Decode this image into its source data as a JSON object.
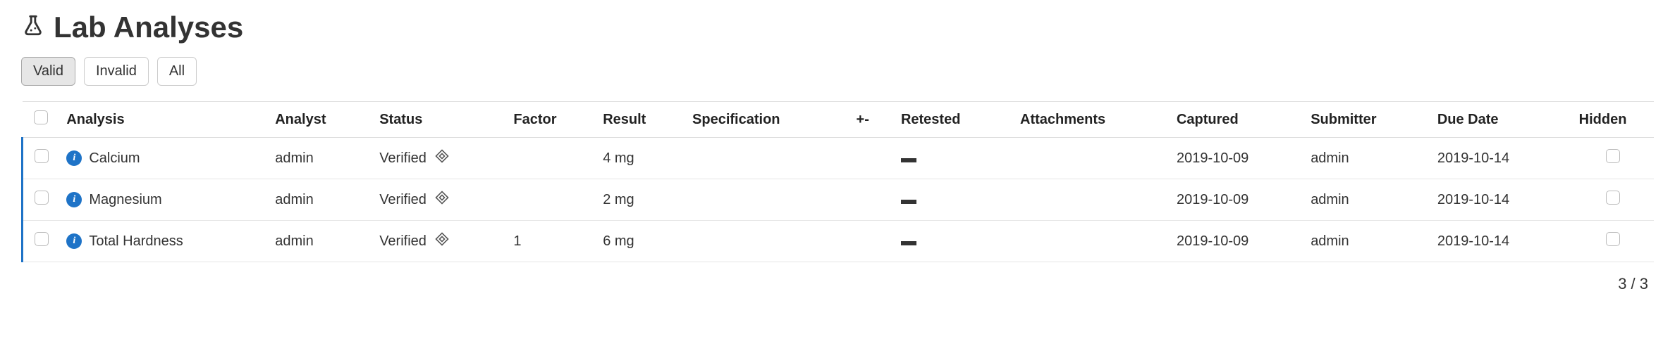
{
  "page": {
    "title": "Lab Analyses"
  },
  "filters": {
    "valid": "Valid",
    "invalid": "Invalid",
    "all": "All"
  },
  "columns": {
    "analysis": "Analysis",
    "analyst": "Analyst",
    "status": "Status",
    "factor": "Factor",
    "result": "Result",
    "specification": "Specification",
    "plus_minus": "+-",
    "retested": "Retested",
    "attachments": "Attachments",
    "captured": "Captured",
    "submitter": "Submitter",
    "due_date": "Due Date",
    "hidden": "Hidden"
  },
  "rows": [
    {
      "analysis": "Calcium",
      "analyst": "admin",
      "status": "Verified",
      "factor": "",
      "result": "4 mg",
      "specification": "",
      "plus_minus": "",
      "captured": "2019-10-09",
      "submitter": "admin",
      "due_date": "2019-10-14"
    },
    {
      "analysis": "Magnesium",
      "analyst": "admin",
      "status": "Verified",
      "factor": "",
      "result": "2 mg",
      "specification": "",
      "plus_minus": "",
      "captured": "2019-10-09",
      "submitter": "admin",
      "due_date": "2019-10-14"
    },
    {
      "analysis": "Total Hardness",
      "analyst": "admin",
      "status": "Verified",
      "factor": "1",
      "result": "6 mg",
      "specification": "",
      "plus_minus": "",
      "captured": "2019-10-09",
      "submitter": "admin",
      "due_date": "2019-10-14"
    }
  ],
  "pager": {
    "label": "3 / 3"
  }
}
